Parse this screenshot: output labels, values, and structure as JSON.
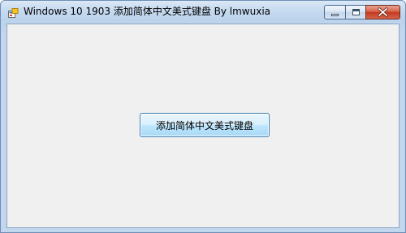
{
  "window": {
    "title": "Windows 10 1903 添加简体中文美式键盘 By lmwuxia",
    "app_icon": "generic-app-icon"
  },
  "caption_buttons": {
    "minimize_icon": "minimize-icon",
    "maximize_icon": "maximize-icon",
    "close_icon": "close-icon"
  },
  "main": {
    "add_keyboard_button_label": "添加简体中文美式键盘"
  }
}
